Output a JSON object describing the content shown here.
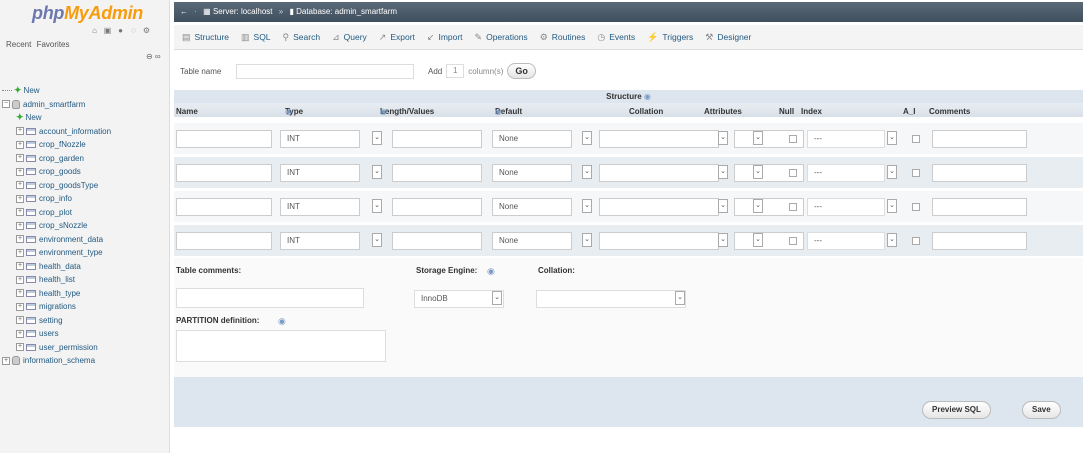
{
  "app": {
    "logo_php": "php",
    "logo_mya": "MyAdmin"
  },
  "nav": {
    "links": [
      "Recent",
      "Favorites"
    ],
    "new_label": "New",
    "db_name": "admin_smartfarm",
    "db_new_label": "New",
    "tables": [
      "account_information",
      "crop_fNozzle",
      "crop_garden",
      "crop_goods",
      "crop_goodsType",
      "crop_info",
      "crop_plot",
      "crop_sNozzle",
      "environment_data",
      "environment_type",
      "health_data",
      "health_list",
      "health_type",
      "migrations",
      "setting",
      "users",
      "user_permission"
    ],
    "other_db": "information_schema"
  },
  "breadcrumb": {
    "server": "Server: localhost",
    "database": "Database: admin_smartfarm"
  },
  "menu": [
    "Structure",
    "SQL",
    "Search",
    "Query",
    "Export",
    "Import",
    "Operations",
    "Routines",
    "Events",
    "Triggers",
    "Designer"
  ],
  "form": {
    "table_name_label": "Table name",
    "add_label": "Add",
    "add_value": "1",
    "columns_label": "column(s)",
    "go_label": "Go"
  },
  "structure": {
    "caption": "Structure",
    "headers": [
      "Name",
      "Type",
      "Length/Values",
      "Default",
      "Collation",
      "Attributes",
      "Null",
      "Index",
      "A_I",
      "Comments"
    ],
    "rows": [
      {
        "type": "INT",
        "default": "None",
        "index": "---"
      },
      {
        "type": "INT",
        "default": "None",
        "index": "---"
      },
      {
        "type": "INT",
        "default": "None",
        "index": "---"
      },
      {
        "type": "INT",
        "default": "None",
        "index": "---"
      }
    ]
  },
  "lower": {
    "table_comments": "Table comments:",
    "storage_engine": "Storage Engine:",
    "storage_value": "InnoDB",
    "collation": "Collation:",
    "partition": "PARTITION definition:"
  },
  "buttons": {
    "preview": "Preview SQL",
    "save": "Save"
  }
}
